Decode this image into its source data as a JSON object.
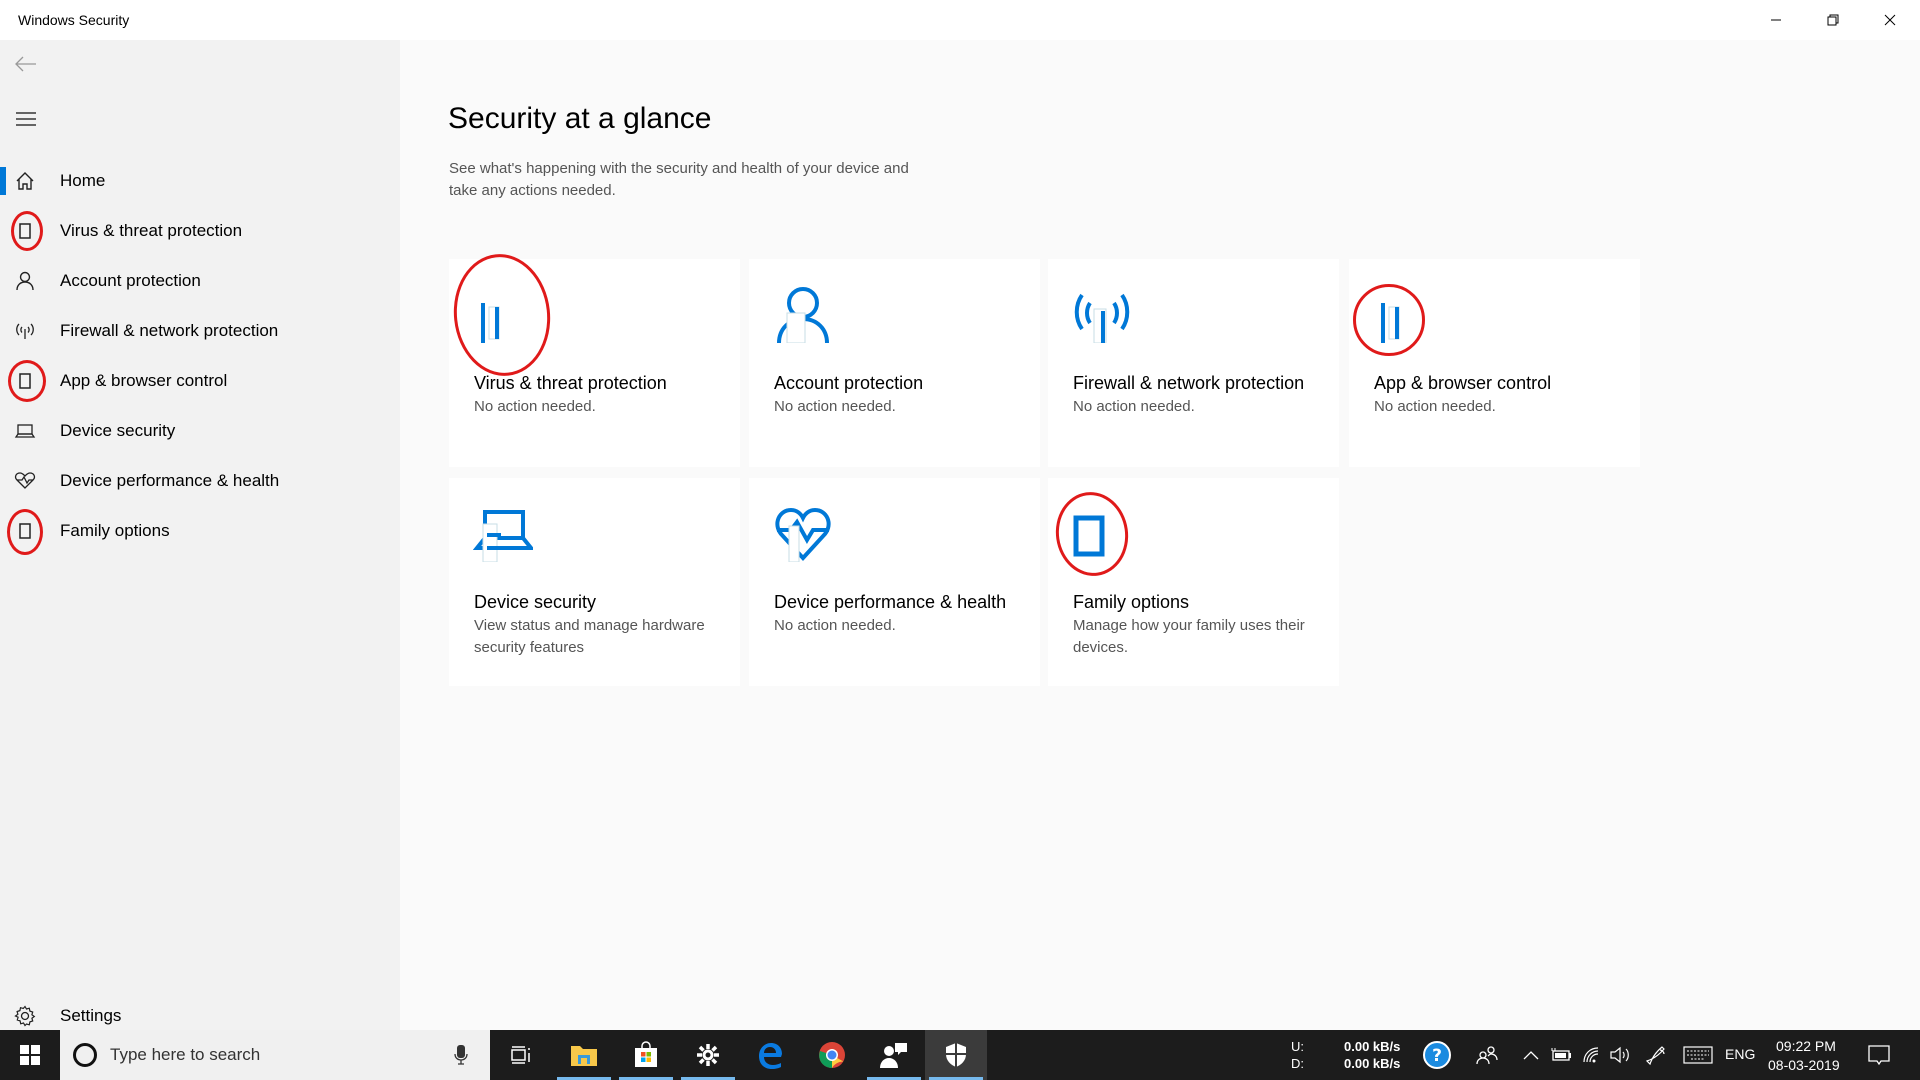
{
  "window": {
    "title": "Windows Security",
    "controls": {
      "minimize": "minimize-icon",
      "restore": "restore-icon",
      "close": "close-icon"
    }
  },
  "sidebar": {
    "back_icon": "back-arrow-icon",
    "menu_icon": "hamburger-menu-icon",
    "items": [
      {
        "label": "Home",
        "icon": "home-icon",
        "selected": true
      },
      {
        "label": "Virus & threat protection",
        "icon": "missing-glyph-icon",
        "annotated": true
      },
      {
        "label": "Account protection",
        "icon": "person-icon"
      },
      {
        "label": "Firewall & network protection",
        "icon": "antenna-icon"
      },
      {
        "label": "App & browser control",
        "icon": "missing-glyph-icon",
        "annotated": true
      },
      {
        "label": "Device security",
        "icon": "laptop-icon"
      },
      {
        "label": "Device performance & health",
        "icon": "heart-pulse-icon"
      },
      {
        "label": "Family options",
        "icon": "missing-glyph-icon",
        "annotated": true
      }
    ],
    "settings": {
      "label": "Settings",
      "icon": "gear-icon"
    }
  },
  "main": {
    "title": "Security at a glance",
    "subtitle": "See what's happening with the security and health of your device and take any actions needed.",
    "tiles": [
      {
        "title": "Virus & threat protection",
        "status": "No action needed.",
        "icon": "missing-glyph-icon",
        "annotated": true
      },
      {
        "title": "Account protection",
        "status": "No action needed.",
        "icon": "person-icon"
      },
      {
        "title": "Firewall & network protection",
        "status": "No action needed.",
        "icon": "antenna-icon"
      },
      {
        "title": "App & browser control",
        "status": "No action needed.",
        "icon": "missing-glyph-icon",
        "annotated": true
      },
      {
        "title": "Device security",
        "status": "View status and manage hardware security features",
        "icon": "laptop-icon"
      },
      {
        "title": "Device performance & health",
        "status": "No action needed.",
        "icon": "heart-pulse-icon"
      },
      {
        "title": "Family options",
        "status": "Manage how your family uses their devices.",
        "icon": "missing-glyph-icon",
        "annotated": true
      }
    ],
    "accent_color": "#0078d7",
    "annotation_color": "#e01a1a"
  },
  "taskbar": {
    "search_placeholder": "Type here to search",
    "apps": [
      {
        "name": "task-view",
        "running": false
      },
      {
        "name": "file-explorer",
        "running": true
      },
      {
        "name": "microsoft-store",
        "running": true
      },
      {
        "name": "settings",
        "running": true
      },
      {
        "name": "edge",
        "running": false
      },
      {
        "name": "chrome",
        "running": false
      },
      {
        "name": "feedback-hub",
        "running": true
      },
      {
        "name": "windows-security",
        "running": true,
        "active": true
      }
    ],
    "network_meter": {
      "upload_label": "U:",
      "upload_value": "0.00 kB/s",
      "download_label": "D:",
      "download_value": "0.00 kB/s"
    },
    "language": "ENG",
    "time": "09:22 PM",
    "date": "08-03-2019"
  }
}
